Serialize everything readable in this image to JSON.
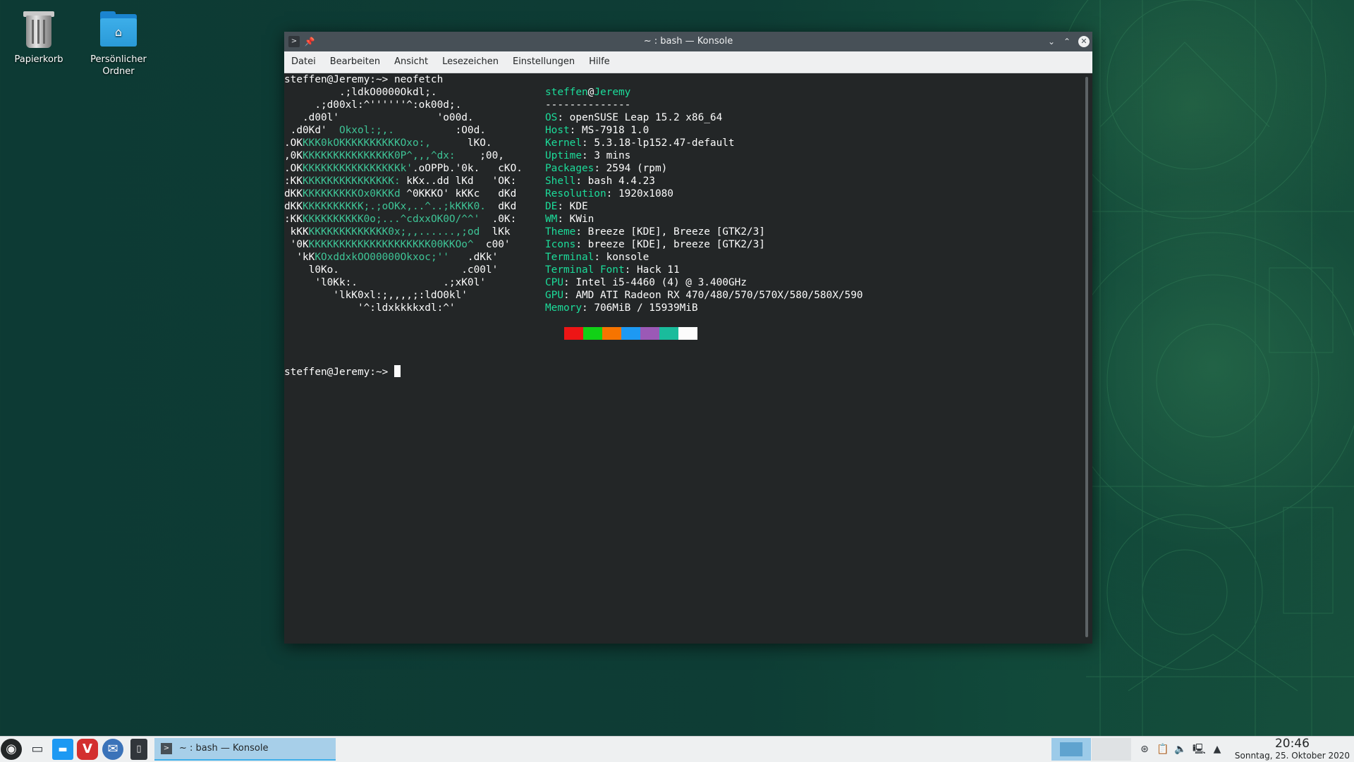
{
  "desktop": {
    "icons": [
      {
        "label": "Papierkorb",
        "icon": "trash-icon"
      },
      {
        "label": "Persönlicher Ordner",
        "label_line1": "Persönlicher",
        "label_line2": "Ordner",
        "icon": "home-folder-icon"
      }
    ]
  },
  "window": {
    "title": "~ : bash — Konsole",
    "menu": [
      "Datei",
      "Bearbeiten",
      "Ansicht",
      "Lesezeichen",
      "Einstellungen",
      "Hilfe"
    ]
  },
  "terminal": {
    "command_line": "steffen@Jeremy:~> neofetch",
    "prompt": "steffen@Jeremy:~> ",
    "logo": [
      {
        "w1": "         .;ldkO0000Okdl;.",
        "g": "",
        "w2": ""
      },
      {
        "w1": "     .;d00xl:^''''''^:ok00d;.",
        "g": "",
        "w2": ""
      },
      {
        "w1": "   .d00l'",
        "g": "",
        "w2": "                'o00d."
      },
      {
        "w1": " .d0Kd'  ",
        "g": "Okxol:;,.",
        "w2": "          :O0d."
      },
      {
        "w1": ".OK",
        "g": "KKK0kOKKKKKKKKKKOxo:,",
        "w2": "      lKO."
      },
      {
        "w1": ",0K",
        "g": "KKKKKKKKKKKKKKK0P^,,,^dx:",
        "w2": "    ;00,"
      },
      {
        "w1": ".OK",
        "g": "KKKKKKKKKKKKKKKKk'",
        "w2": ".oOPPb.'0k.   cKO."
      },
      {
        "w1": ":KK",
        "g": "KKKKKKKKKKKKKKK:",
        "w2": " kKx..dd lKd   'OK:"
      },
      {
        "w1": "dKK",
        "g": "KKKKKKKKKOx0KKKd",
        "w2": " ^0KKKO' kKKc   dKd"
      },
      {
        "w1": "dKK",
        "g": "KKKKKKKKKK;.;oOKx,..^..;kKKK0.",
        "w2": "  dKd"
      },
      {
        "w1": ":KK",
        "g": "KKKKKKKKKK0o;...^cdxxOK0O/^^'",
        "w2": "  .0K:"
      },
      {
        "w1": " kKK",
        "g": "KKKKKKKKKKKKK0x;,,......,;od",
        "w2": "  lKk"
      },
      {
        "w1": " '0K",
        "g": "KKKKKKKKKKKKKKKKKKKK00KKOo^",
        "w2": "  c00'"
      },
      {
        "w1": "  'kK",
        "g": "KOxddxkOO00000Okxoc;''",
        "w2": "   .dKk'"
      },
      {
        "w1": "    l0Ko.",
        "g": "",
        "w2": "                    .c00l'"
      },
      {
        "w1": "     'l0Kk:.",
        "g": "",
        "w2": "              .;xK0l'"
      },
      {
        "w1": "        'lkK0xl:;,,,,;:ldO0kl'",
        "g": "",
        "w2": ""
      },
      {
        "w1": "            '^:ldxkkkkxdl:^'",
        "g": "",
        "w2": ""
      }
    ],
    "header": {
      "user": "steffen",
      "at": "@",
      "host": "Jeremy",
      "separator": "--------------"
    },
    "info": [
      {
        "key": "OS",
        "value": "openSUSE Leap 15.2 x86_64"
      },
      {
        "key": "Host",
        "value": "MS-7918 1.0"
      },
      {
        "key": "Kernel",
        "value": "5.3.18-lp152.47-default"
      },
      {
        "key": "Uptime",
        "value": "3 mins"
      },
      {
        "key": "Packages",
        "value": "2594 (rpm)"
      },
      {
        "key": "Shell",
        "value": "bash 4.4.23"
      },
      {
        "key": "Resolution",
        "value": "1920x1080"
      },
      {
        "key": "DE",
        "value": "KDE"
      },
      {
        "key": "WM",
        "value": "KWin"
      },
      {
        "key": "Theme",
        "value": "Breeze [KDE], Breeze [GTK2/3]"
      },
      {
        "key": "Icons",
        "value": "breeze [KDE], breeze [GTK2/3]"
      },
      {
        "key": "Terminal",
        "value": "konsole"
      },
      {
        "key": "Terminal Font",
        "value": "Hack 11"
      },
      {
        "key": "CPU",
        "value": "Intel i5-4460 (4) @ 3.400GHz"
      },
      {
        "key": "GPU",
        "value": "AMD ATI Radeon RX 470/480/570/570X/580/580X/590"
      },
      {
        "key": "Memory",
        "value": "706MiB / 15939MiB"
      }
    ],
    "palette": [
      "#ed1515",
      "#11d116",
      "#f67400",
      "#1d99f3",
      "#9b59b6",
      "#1abc9c",
      "#fcfcfc"
    ]
  },
  "taskbar": {
    "launchers": [
      "opensuse-menu-icon",
      "desktop-show-icon",
      "file-manager-icon",
      "vivaldi-icon",
      "thunderbird-icon",
      "konsole-launcher-icon"
    ],
    "task_label": "~ : bash — Konsole",
    "tray": [
      "updater-icon",
      "clipboard-icon",
      "volume-icon",
      "network-icon",
      "tray-expand-icon"
    ],
    "clock_time": "20:46",
    "clock_date": "Sonntag, 25. Oktober 2020"
  },
  "colors": {
    "accent": "#3daee9",
    "terminal_bg": "#232627",
    "neofetch_green": "#3ec496"
  }
}
